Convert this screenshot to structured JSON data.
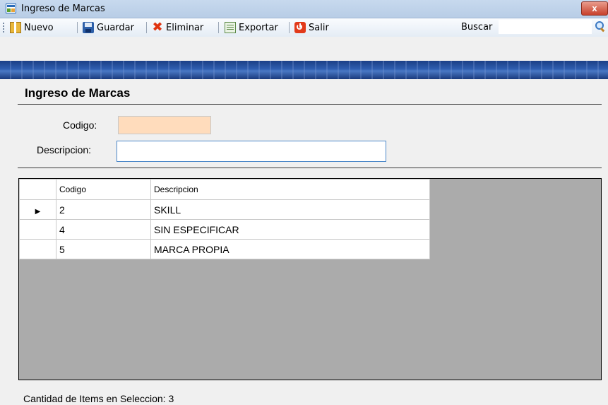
{
  "window": {
    "title": "Ingreso de Marcas",
    "close_label": "x"
  },
  "toolbar": {
    "buttons": [
      {
        "label": "Nuevo",
        "icon": "new-icon"
      },
      {
        "label": "Guardar",
        "icon": "save-icon"
      },
      {
        "label": "Eliminar",
        "icon": "delete-icon"
      },
      {
        "label": "Exportar",
        "icon": "excel-export-icon"
      },
      {
        "label": "Salir",
        "icon": "power-icon"
      }
    ],
    "search_label": "Buscar",
    "search_value": ""
  },
  "form": {
    "title": "Ingreso de Marcas",
    "codigo_label": "Codigo:",
    "codigo_value": "",
    "descripcion_label": "Descripcion:",
    "descripcion_value": ""
  },
  "grid": {
    "columns": [
      "Codigo",
      "Descripcion"
    ],
    "current_row_indicator": "▶",
    "rows": [
      {
        "codigo": "2",
        "descripcion": "SKILL"
      },
      {
        "codigo": "4",
        "descripcion": "SIN ESPECIFICAR"
      },
      {
        "codigo": "5",
        "descripcion": "MARCA PROPIA"
      }
    ]
  },
  "status": {
    "text": "Cantidad de Items en Seleccion: 3"
  },
  "colors": {
    "codigo_field_bg": "#ffdcbc",
    "banner": "#2f5eb0",
    "grid_bg": "#ababab"
  }
}
